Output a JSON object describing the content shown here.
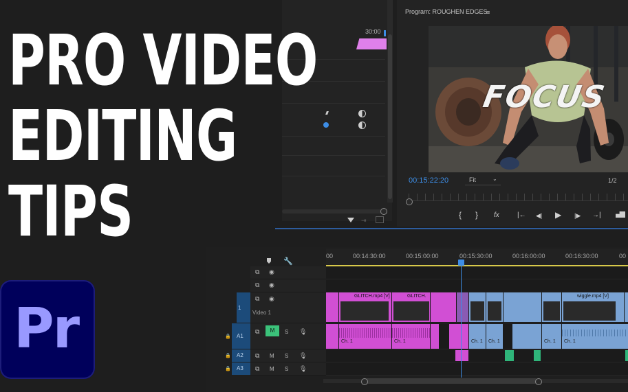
{
  "title": {
    "line1": "PRO VIDEO",
    "line2": "EDITING",
    "line3": "TIPS"
  },
  "logo": {
    "text": "Pr"
  },
  "source_panel": {
    "timecode": "30:00"
  },
  "program_monitor": {
    "title": "Program: ROUGHEN EDGES",
    "menu_icon": "hamburger-icon",
    "overlay_text": "FOCUS",
    "timecode": "00:15:22:20",
    "zoom": "Fit",
    "resolution": "1/2",
    "controls": [
      "{",
      "}",
      "fx",
      "|←",
      "◀|",
      "▶",
      "|▶",
      "→|"
    ]
  },
  "timeline": {
    "timecodes": [
      "00",
      "00:14:30:00",
      "00:15:00:00",
      "00:15:30:00",
      "00:16:00:00",
      "00:16:30:00",
      "00"
    ],
    "video_track_label": "Video 1",
    "video_track_id": "V1",
    "audio_tracks": [
      {
        "id": "A1",
        "m": "M",
        "s": "S"
      },
      {
        "id": "A2",
        "m": "M",
        "s": "S"
      },
      {
        "id": "A3",
        "m": "M",
        "s": "S"
      }
    ],
    "clips": {
      "glitch1": "GLITCH.mp4 [V]",
      "glitch2": "GLITCH.",
      "wiggle": "wiggle.mp4 [V]",
      "channel": "Ch. 1"
    }
  },
  "colors": {
    "accent_blue": "#3d8de5",
    "clip_magenta": "#d14fd4",
    "clip_blue": "#7aa3d4",
    "logo_bg": "#00005b",
    "logo_text": "#9999ff"
  }
}
